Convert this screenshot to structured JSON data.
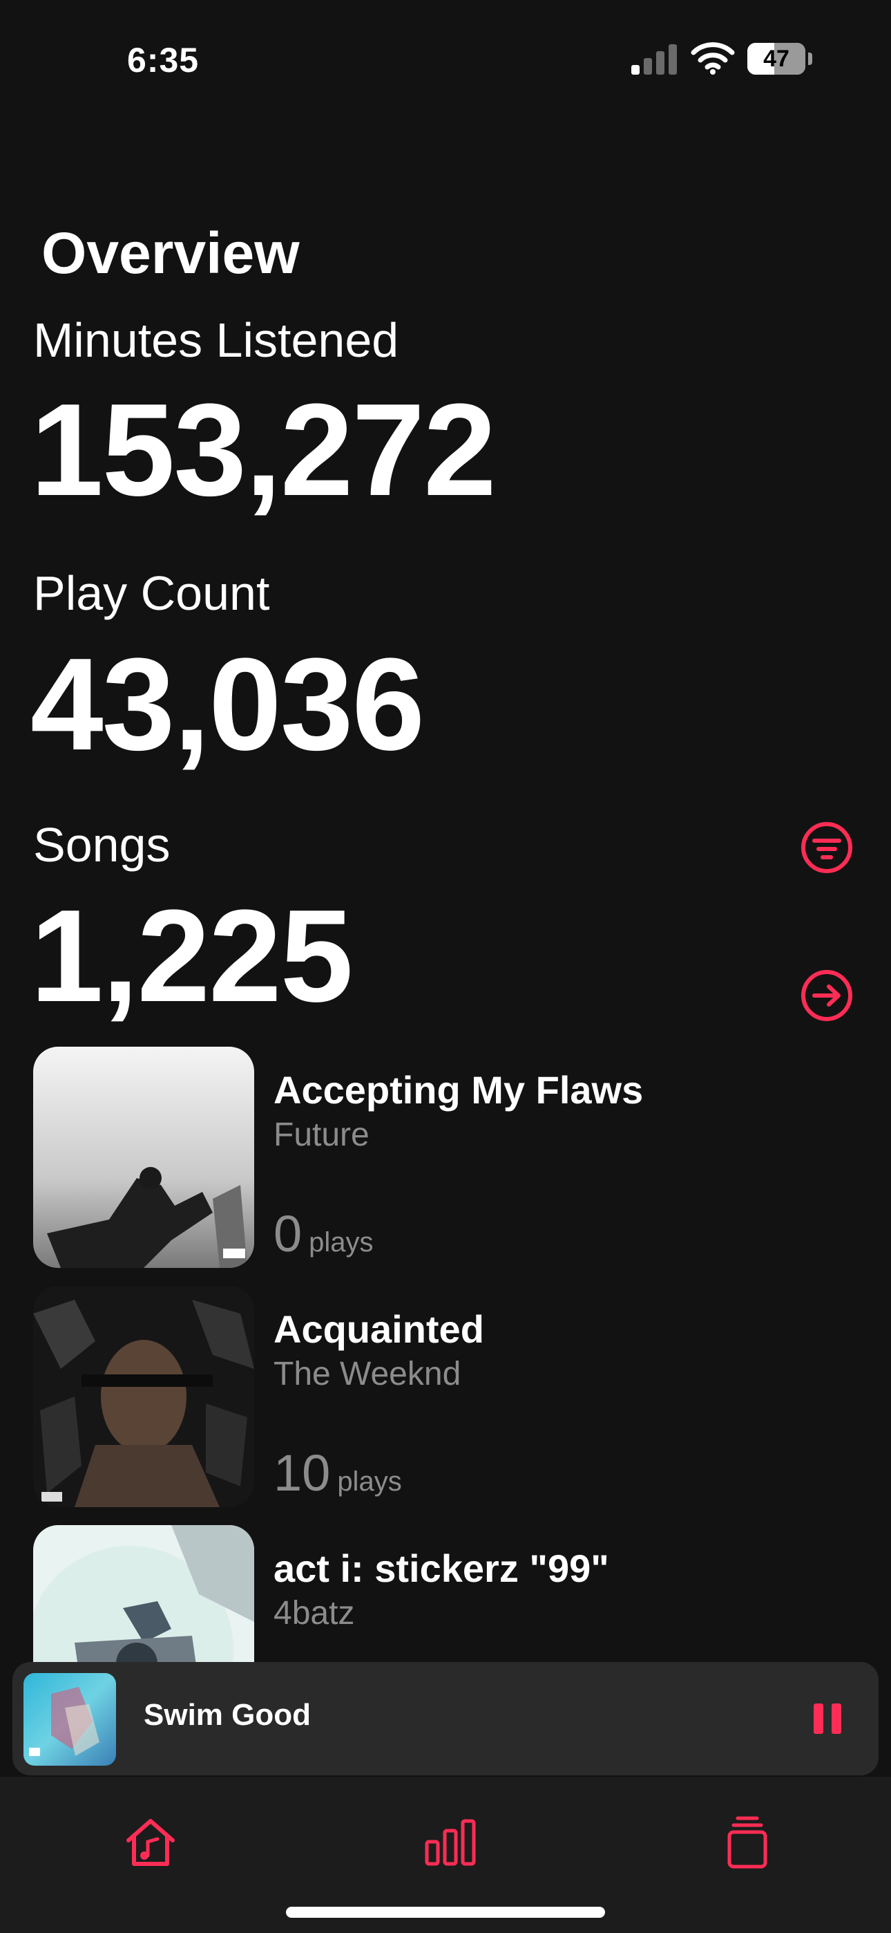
{
  "status_bar": {
    "time": "6:35",
    "battery": "47",
    "battery_level": 0.47
  },
  "overview": {
    "title": "Overview",
    "minutes_label": "Minutes Listened",
    "minutes_value": "153,272",
    "playcount_label": "Play Count",
    "playcount_value": "43,036",
    "songs_label": "Songs",
    "songs_value": "1,225"
  },
  "songs": [
    {
      "title": "Accepting My Flaws",
      "artist": "Future",
      "plays": "0",
      "plays_word": "plays"
    },
    {
      "title": "Acquainted",
      "artist": "The Weeknd",
      "plays": "10",
      "plays_word": "plays"
    },
    {
      "title": "act i: stickerz \"99\"",
      "artist": "4batz",
      "plays": "",
      "plays_word": ""
    }
  ],
  "now_playing": {
    "title": "Swim Good"
  },
  "icons": {
    "filter": "filter-icon",
    "navigate": "arrow-right-circle-icon",
    "pause": "pause-icon",
    "home": "home-music-icon",
    "stats": "bar-chart-icon",
    "library": "stack-icon"
  },
  "colors": {
    "accent": "#ff2d55",
    "background": "#121212",
    "secondary_text": "#8c8c8c"
  }
}
